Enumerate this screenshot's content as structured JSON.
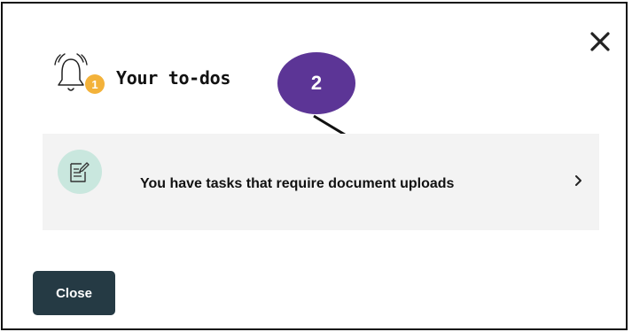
{
  "dialog": {
    "title": "Your to-dos",
    "notification_count": "1",
    "close_icon": "close-icon",
    "bell_icon": "bell-icon"
  },
  "annotation": {
    "step_number": "2",
    "color": "#5c3596"
  },
  "task": {
    "label": "You have tasks that require document uploads",
    "icon": "document-edit-icon",
    "chevron": "chevron-right-icon"
  },
  "footer": {
    "close_label": "Close"
  },
  "colors": {
    "badge": "#f3b23a",
    "icon_bg": "#c9e7de",
    "card_bg": "#f3f3f3",
    "button_bg": "#253a44"
  }
}
